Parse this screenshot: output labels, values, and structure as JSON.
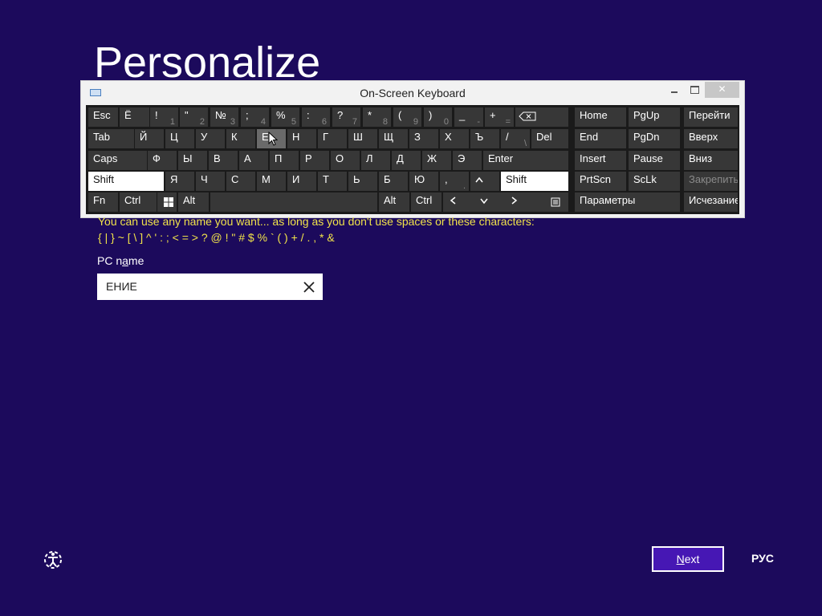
{
  "page": {
    "title": "Personalize",
    "description_line1": "You can use any name you want... as long as you don't use spaces or these characters:",
    "description_line2": "{ | } ~ [ \\ ] ^ ' : ; < = > ? @ ! \" # $ % ` ( ) + / . , * &",
    "pc_name_label_pre": "PC n",
    "pc_name_label_u": "a",
    "pc_name_label_post": "me",
    "pc_name_value": "ЕНИЕ"
  },
  "footer": {
    "next_pre": "",
    "next_u": "N",
    "next_post": "ext",
    "language": "РУС"
  },
  "osk": {
    "title": "On-Screen Keyboard",
    "rows": [
      [
        {
          "label": "Esc"
        },
        {
          "label": "Ё"
        },
        {
          "label": "!",
          "sub": "1"
        },
        {
          "label": "\"",
          "sub": "2"
        },
        {
          "label": "№",
          "sub": "3"
        },
        {
          "label": ";",
          "sub": "4"
        },
        {
          "label": "%",
          "sub": "5"
        },
        {
          "label": ":",
          "sub": "6"
        },
        {
          "label": "?",
          "sub": "7"
        },
        {
          "label": "*",
          "sub": "8"
        },
        {
          "label": "(",
          "sub": "9"
        },
        {
          "label": ")",
          "sub": "0"
        },
        {
          "label": "_",
          "sub": "-"
        },
        {
          "label": "+",
          "sub": "="
        },
        {
          "label": "⌫"
        }
      ],
      [
        {
          "label": "Tab"
        },
        {
          "label": "Й"
        },
        {
          "label": "Ц"
        },
        {
          "label": "У"
        },
        {
          "label": "К"
        },
        {
          "label": "Е"
        },
        {
          "label": "Н"
        },
        {
          "label": "Г"
        },
        {
          "label": "Ш"
        },
        {
          "label": "Щ"
        },
        {
          "label": "З"
        },
        {
          "label": "Х"
        },
        {
          "label": "Ъ"
        },
        {
          "label": "/",
          "sub": "\\"
        },
        {
          "label": "Del"
        }
      ],
      [
        {
          "label": "Caps"
        },
        {
          "label": "Ф"
        },
        {
          "label": "Ы"
        },
        {
          "label": "В"
        },
        {
          "label": "А"
        },
        {
          "label": "П"
        },
        {
          "label": "Р"
        },
        {
          "label": "О"
        },
        {
          "label": "Л"
        },
        {
          "label": "Д"
        },
        {
          "label": "Ж"
        },
        {
          "label": "Э"
        },
        {
          "label": "Enter"
        }
      ],
      [
        {
          "label": "Shift"
        },
        {
          "label": "Я"
        },
        {
          "label": "Ч"
        },
        {
          "label": "С"
        },
        {
          "label": "М"
        },
        {
          "label": "И"
        },
        {
          "label": "Т"
        },
        {
          "label": "Ь"
        },
        {
          "label": "Б"
        },
        {
          "label": "Ю"
        },
        {
          "label": ",",
          "sub": "."
        },
        {
          "label": "^"
        },
        {
          "label": "Shift"
        }
      ],
      [
        {
          "label": "Fn"
        },
        {
          "label": "Ctrl"
        },
        {
          "label": "win"
        },
        {
          "label": "Alt"
        },
        {
          "label": ""
        },
        {
          "label": "Alt"
        },
        {
          "label": "Ctrl"
        },
        {
          "label": "<"
        },
        {
          "label": "v"
        },
        {
          "label": ">"
        },
        {
          "label": "menu"
        }
      ]
    ],
    "nav_keys": [
      {
        "label": "Home"
      },
      {
        "label": "PgUp"
      },
      {
        "label": "End"
      },
      {
        "label": "PgDn"
      },
      {
        "label": "Insert"
      },
      {
        "label": "Pause"
      },
      {
        "label": "PrtScn"
      },
      {
        "label": "ScLk"
      },
      {
        "label": "Параметры"
      }
    ],
    "side_keys": [
      {
        "label": "Перейти"
      },
      {
        "label": "Вверх"
      },
      {
        "label": "Вниз"
      },
      {
        "label": "Закрепить"
      },
      {
        "label": "Исчезание"
      }
    ]
  }
}
